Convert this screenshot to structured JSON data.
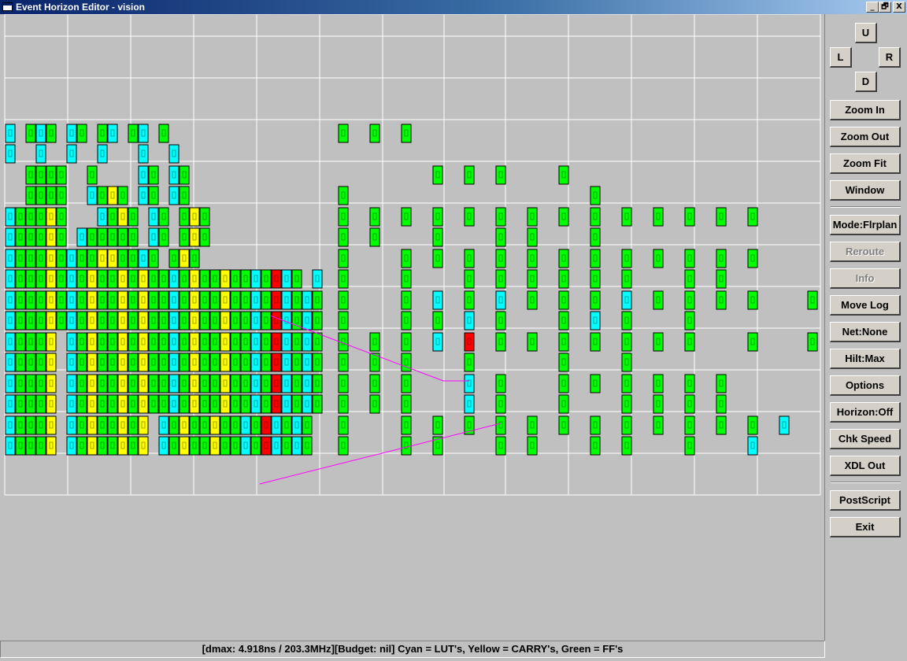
{
  "window": {
    "title": "Event Horizon Editor - vision",
    "buttons": {
      "minimize": "_",
      "restore": "🗗",
      "close": "X"
    }
  },
  "nav": {
    "up": "U",
    "left": "L",
    "right": "R",
    "down": "D"
  },
  "buttons": {
    "zoom_in": "Zoom In",
    "zoom_out": "Zoom Out",
    "zoom_fit": "Zoom Fit",
    "window": "Window",
    "mode": "Mode:Flrplan",
    "reroute": "Reroute",
    "info": "Info",
    "move_log": "Move Log",
    "net": "Net:None",
    "hilt": "Hilt:Max",
    "options": "Options",
    "horizon": "Horizon:Off",
    "chk_speed": "Chk Speed",
    "xdl_out": "XDL Out",
    "postscript": "PostScript",
    "exit": "Exit"
  },
  "status": {
    "text": "[dmax:  4.918ns / 203.3MHz][Budget: nil] Cyan = LUT's, Yellow = CARRY's, Green = FF's"
  },
  "colors": {
    "lut": "#00ffff",
    "carry": "#ffff00",
    "ff": "#00ff00",
    "selected": "#ff0000",
    "net": "#ff00ff",
    "grid": "#ffffff",
    "background": "#c0c0c0"
  }
}
